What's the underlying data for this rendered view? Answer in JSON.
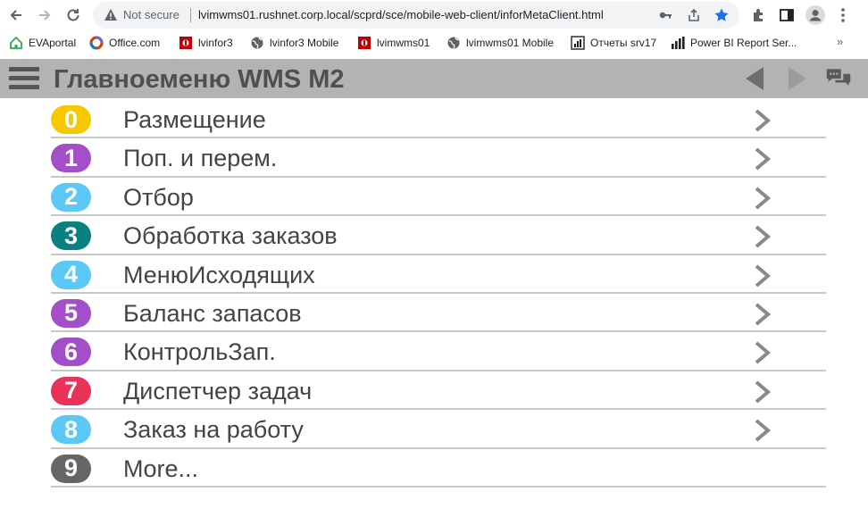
{
  "browser": {
    "not_secure": "Not secure",
    "url": "lvimwms01.rushnet.corp.local/scprd/sce/mobile-web-client/inforMetaClient.html",
    "bookmarks": [
      {
        "label": "EVAportal",
        "icon": "house-icon",
        "color": "#34a853"
      },
      {
        "label": "Office.com",
        "icon": "office-icon",
        "color": "#d83b01"
      },
      {
        "label": "lvinfor3",
        "icon": "infor-icon",
        "color": "#c00000"
      },
      {
        "label": "lvinfor3 Mobile",
        "icon": "globe-icon",
        "color": "#5f6368"
      },
      {
        "label": "lvimwms01",
        "icon": "infor-icon",
        "color": "#c00000"
      },
      {
        "label": "lvimwms01 Mobile",
        "icon": "globe-icon",
        "color": "#5f6368"
      },
      {
        "label": "Отчеты srv17",
        "icon": "report-icon",
        "color": "#202124"
      },
      {
        "label": "Power BI Report Ser...",
        "icon": "powerbi-icon",
        "color": "#202124"
      }
    ],
    "more": "»"
  },
  "header": {
    "title": "Главноеменю WMS M2"
  },
  "menu": {
    "items": [
      {
        "num": "0",
        "label": "Размещение",
        "color": "#f5c800",
        "chevron": true
      },
      {
        "num": "1",
        "label": "Поп. и перем.",
        "color": "#a24fc9",
        "chevron": true
      },
      {
        "num": "2",
        "label": "Отбор",
        "color": "#5bc8f5",
        "chevron": true
      },
      {
        "num": "3",
        "label": "Обработка заказов",
        "color": "#0b8080",
        "chevron": true
      },
      {
        "num": "4",
        "label": "МенюИсходящих",
        "color": "#5bc8f5",
        "chevron": true
      },
      {
        "num": "5",
        "label": "Баланс запасов",
        "color": "#a24fc9",
        "chevron": true
      },
      {
        "num": "6",
        "label": "КонтрольЗап.",
        "color": "#a24fc9",
        "chevron": true
      },
      {
        "num": "7",
        "label": "Диспетчер задач",
        "color": "#e8325a",
        "chevron": true
      },
      {
        "num": "8",
        "label": "Заказ на работу",
        "color": "#5bc8f5",
        "chevron": true
      },
      {
        "num": "9",
        "label": "More...",
        "color": "#666666",
        "chevron": false
      }
    ]
  }
}
